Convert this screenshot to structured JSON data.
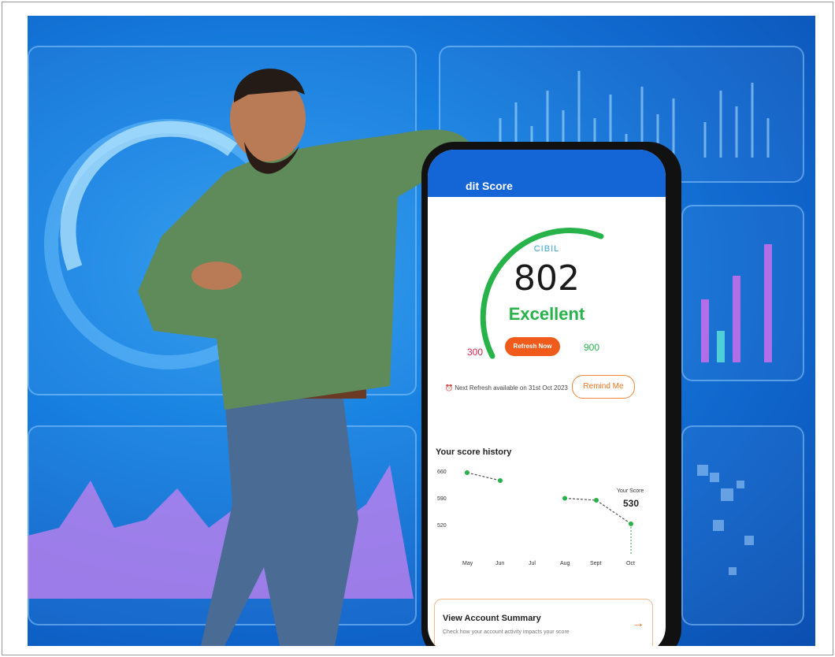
{
  "app": {
    "title": "dit Score",
    "bureau": "CIBIL",
    "score": "802",
    "rating": "Excellent",
    "score_min": "300",
    "score_max": "900",
    "refresh_button": "Refresh Now",
    "next_refresh_text": "Next Refresh available on 31st Oct 2023",
    "remind_button": "Remind Me",
    "accent_color": "#f05a1a",
    "brand_color": "#1466d6",
    "good_color": "#27b24a"
  },
  "history": {
    "title": "Your score history",
    "y_ticks": [
      "660",
      "590",
      "520"
    ],
    "x_ticks": [
      "May",
      "Jun",
      "Jul",
      "Aug",
      "Sept",
      "Oct"
    ],
    "your_score_label": "Your Score",
    "your_score_value": "530"
  },
  "summary": {
    "title": "View Account Summary",
    "subtitle": "Check how your account activity impacts your score",
    "arrow_icon": "arrow-right-icon"
  },
  "chart_data": {
    "type": "line",
    "categories": [
      "May",
      "Jun",
      "Jul",
      "Aug",
      "Sept",
      "Oct"
    ],
    "series": [
      {
        "values": [
          660,
          640,
          null,
          595,
          590,
          530
        ]
      }
    ],
    "ylim": [
      480,
      680
    ],
    "title": "Your score history"
  }
}
